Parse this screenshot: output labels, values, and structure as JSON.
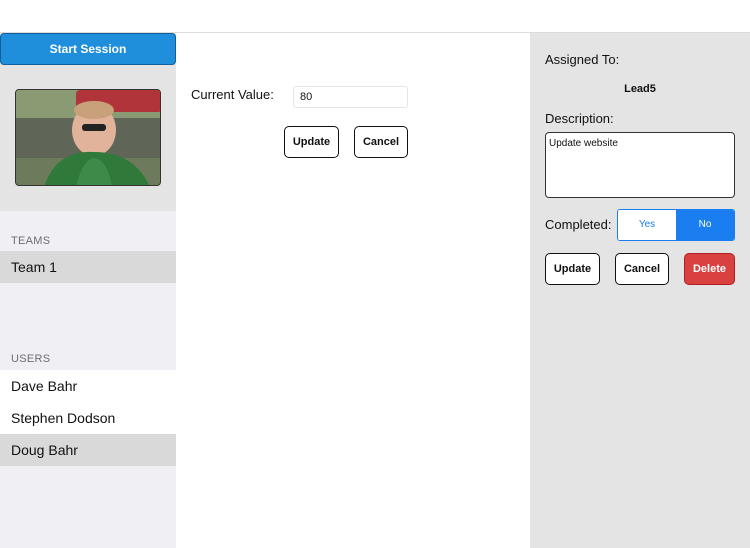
{
  "sidebar": {
    "start_session_label": "Start Session",
    "teams_header": "TEAMS",
    "teams": [
      "Team 1"
    ],
    "users_header": "USERS",
    "users": [
      "Dave Bahr",
      "Stephen Dodson",
      "Doug Bahr"
    ]
  },
  "center": {
    "current_value_label": "Current Value:",
    "current_value": "80",
    "update_label": "Update",
    "cancel_label": "Cancel"
  },
  "detail": {
    "assigned_to_label": "Assigned To:",
    "assigned_to_value": "Lead5",
    "description_label": "Description:",
    "description_value": "Update website",
    "completed_label": "Completed:",
    "completed_yes": "Yes",
    "completed_no": "No",
    "completed_selected": "No",
    "update_label": "Update",
    "cancel_label": "Cancel",
    "delete_label": "Delete"
  },
  "colors": {
    "accent": "#1a7ef0",
    "start_button": "#1f8fdc",
    "delete_button": "#d94040"
  }
}
